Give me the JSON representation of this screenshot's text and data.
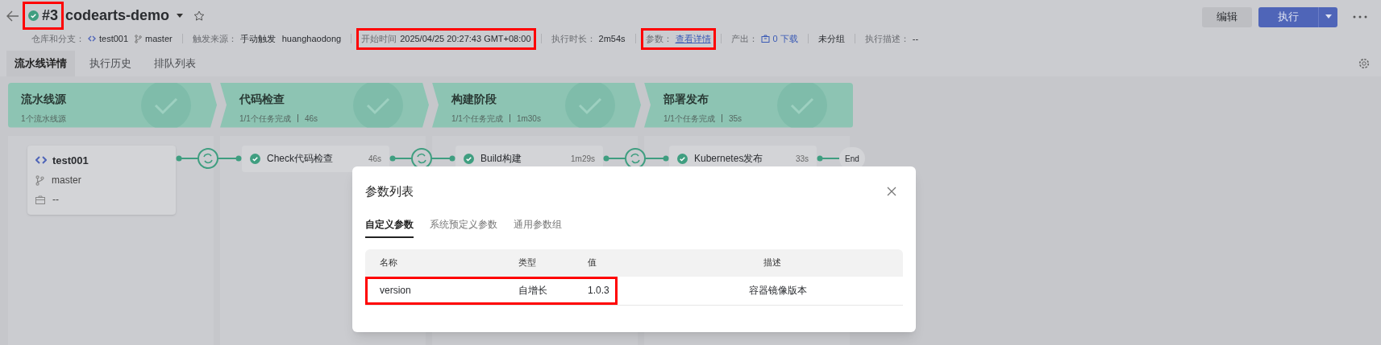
{
  "header": {
    "run_number": "#3",
    "run_highlighted": true,
    "succeeded": true,
    "pipeline_name": "codearts-demo",
    "favorite": false,
    "meta": [
      {
        "kind": "repo",
        "label": "仓库和分支：",
        "repo": "test001",
        "branch": "master",
        "highlighted": false
      },
      {
        "kind": "text",
        "label": "触发来源：",
        "value": "手动触发",
        "extra": "huanghaodong",
        "highlighted": false
      },
      {
        "kind": "text",
        "label": "开始时间",
        "value": "2025/04/25 20:27:43 GMT+08:00",
        "highlighted": true
      },
      {
        "kind": "text",
        "label": "执行时长：",
        "value": "2m54s",
        "highlighted": false
      },
      {
        "kind": "link",
        "label": "参数：",
        "value": "查看详情",
        "highlighted": true
      },
      {
        "kind": "download",
        "label": "产出：",
        "value": "0 下载",
        "highlighted": false
      },
      {
        "kind": "plain",
        "value": "未分组",
        "highlighted": false
      },
      {
        "kind": "text",
        "label": "执行描述：",
        "value": "--",
        "highlighted": false
      }
    ],
    "actions": {
      "edit": "编辑",
      "run": "执行"
    }
  },
  "tabs": [
    {
      "label": "流水线详情",
      "selected": true
    },
    {
      "label": "执行历史",
      "selected": false
    },
    {
      "label": "排队列表",
      "selected": false
    }
  ],
  "stages": [
    {
      "name": "流水线源",
      "summary": "1个流水线源",
      "done": true
    },
    {
      "name": "代码检查",
      "summary": "1/1个任务完成",
      "duration": "46s",
      "done": true
    },
    {
      "name": "构建阶段",
      "summary": "1/1个任务完成",
      "duration": "1m30s",
      "done": true
    },
    {
      "name": "部署发布",
      "summary": "1/1个任务完成",
      "duration": "35s",
      "done": true
    }
  ],
  "source": {
    "repo": "test001",
    "branch": "master",
    "tag": "--"
  },
  "jobs": [
    {
      "name": "Check代码检查",
      "duration": "46s",
      "done": true
    },
    {
      "name": "Build构建",
      "duration": "1m29s",
      "done": true
    },
    {
      "name": "Kubernetes发布",
      "duration": "33s",
      "done": true
    }
  ],
  "end_label": "End",
  "dialog": {
    "title": "参数列表",
    "tabs": [
      {
        "label": "自定义参数",
        "selected": true
      },
      {
        "label": "系统预定义参数",
        "selected": false
      },
      {
        "label": "通用参数组",
        "selected": false
      }
    ],
    "columns": [
      "名称",
      "类型",
      "值",
      "描述"
    ],
    "rows": [
      {
        "name": "version",
        "type": "自增长",
        "value": "1.0.3",
        "description": "容器镜像版本",
        "highlighted": true
      }
    ]
  }
}
